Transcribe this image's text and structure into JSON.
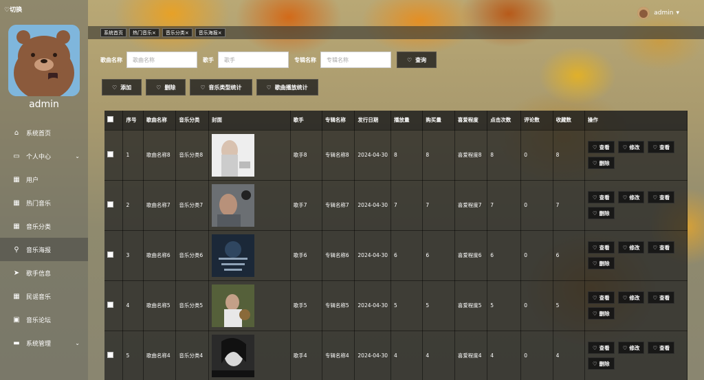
{
  "sidebar": {
    "switch_label": "♡切换",
    "admin_name": "admin",
    "items": [
      {
        "label": "系统首页",
        "icon": "home-icon",
        "glyph": "⌂",
        "expand": false,
        "active": false
      },
      {
        "label": "个人中心",
        "icon": "id-card-icon",
        "glyph": "▭",
        "expand": true,
        "active": false
      },
      {
        "label": "用户",
        "icon": "grid-icon",
        "glyph": "▦",
        "expand": false,
        "active": false
      },
      {
        "label": "热门音乐",
        "icon": "grid-icon",
        "glyph": "▦",
        "expand": false,
        "active": false
      },
      {
        "label": "音乐分类",
        "icon": "grid-icon",
        "glyph": "▦",
        "expand": false,
        "active": false
      },
      {
        "label": "音乐海报",
        "icon": "map-pin-icon",
        "glyph": "⚲",
        "expand": false,
        "active": true
      },
      {
        "label": "歌手信息",
        "icon": "send-icon",
        "glyph": "➤",
        "expand": false,
        "active": false
      },
      {
        "label": "民谣音乐",
        "icon": "grid-icon",
        "glyph": "▦",
        "expand": false,
        "active": false
      },
      {
        "label": "音乐论坛",
        "icon": "clipboard-icon",
        "glyph": "▣",
        "expand": false,
        "active": false
      },
      {
        "label": "系统管理",
        "icon": "monitor-icon",
        "glyph": "▬",
        "expand": true,
        "active": false
      }
    ]
  },
  "header": {
    "user_name": "admin",
    "caret": "▾"
  },
  "tabs": [
    {
      "label": "系统首页"
    },
    {
      "label": "热门音乐×"
    },
    {
      "label": "音乐分类×"
    },
    {
      "label": "音乐海报×"
    }
  ],
  "search": {
    "song_label": "歌曲名称",
    "song_placeholder": "歌曲名称",
    "singer_label": "歌手",
    "singer_placeholder": "歌手",
    "album_label": "专辑名称",
    "album_placeholder": "专辑名称",
    "query_button": "查询"
  },
  "actions": {
    "add": "添加",
    "delete": "删除",
    "type_stats": "音乐类型统计",
    "play_stats": "歌曲播放统计"
  },
  "table": {
    "headers": [
      "序号",
      "歌曲名称",
      "音乐分类",
      "封面",
      "歌手",
      "专辑名称",
      "发行日期",
      "播放量",
      "购买量",
      "喜爱程度",
      "点击次数",
      "评论数",
      "收藏数",
      "操作"
    ],
    "op_view": "查看",
    "op_edit": "修改",
    "op_delete": "删除",
    "rows": [
      {
        "no": "1",
        "song": "歌曲名称8",
        "category": "音乐分类8",
        "singer": "歌手8",
        "album": "专辑名称8",
        "date": "2024-04-30",
        "plays": "8",
        "buys": "8",
        "love": "喜爱程度8",
        "clicks": "8",
        "comments": "0",
        "favs": "8",
        "cover_color": "#e8e8e8"
      },
      {
        "no": "2",
        "song": "歌曲名称7",
        "category": "音乐分类7",
        "singer": "歌手7",
        "album": "专辑名称7",
        "date": "2024-04-30",
        "plays": "7",
        "buys": "7",
        "love": "喜爱程度7",
        "clicks": "7",
        "comments": "0",
        "favs": "7",
        "cover_color": "#6a6e72"
      },
      {
        "no": "3",
        "song": "歌曲名称6",
        "category": "音乐分类6",
        "singer": "歌手6",
        "album": "专辑名称6",
        "date": "2024-04-30",
        "plays": "6",
        "buys": "6",
        "love": "喜爱程度6",
        "clicks": "6",
        "comments": "0",
        "favs": "6",
        "cover_color": "#1c2a3a"
      },
      {
        "no": "4",
        "song": "歌曲名称5",
        "category": "音乐分类5",
        "singer": "歌手5",
        "album": "专辑名称5",
        "date": "2024-04-30",
        "plays": "5",
        "buys": "5",
        "love": "喜爱程度5",
        "clicks": "5",
        "comments": "0",
        "favs": "5",
        "cover_color": "#4f5a34"
      },
      {
        "no": "5",
        "song": "歌曲名称4",
        "category": "音乐分类4",
        "singer": "歌手4",
        "album": "专辑名称4",
        "date": "2024-04-30",
        "plays": "4",
        "buys": "4",
        "love": "喜爱程度4",
        "clicks": "4",
        "comments": "0",
        "favs": "4",
        "cover_color": "#2b2b2b"
      }
    ]
  }
}
